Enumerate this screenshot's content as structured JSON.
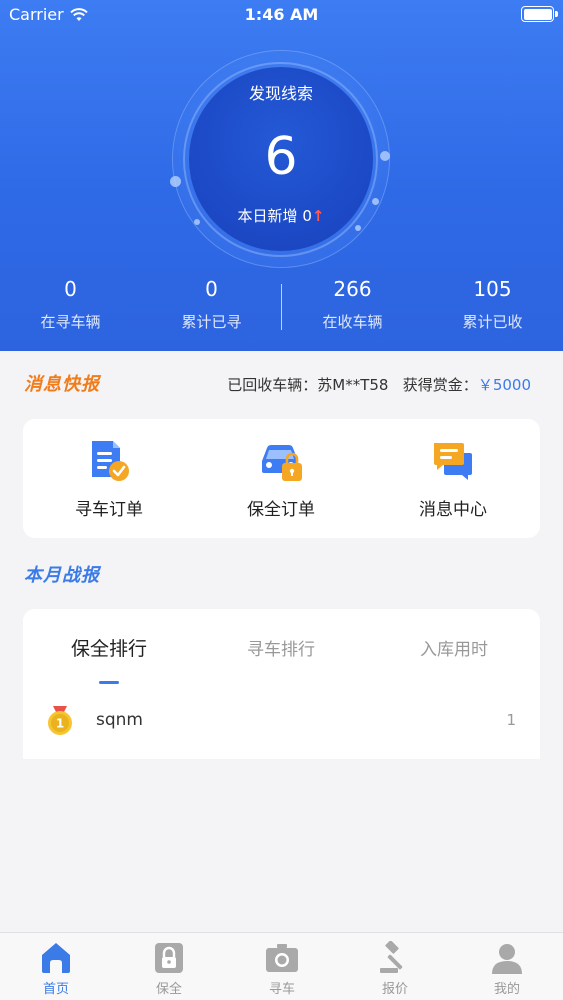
{
  "status_bar": {
    "carrier": "Carrier",
    "time": "1:46 AM"
  },
  "hero": {
    "circle_title": "发现线索",
    "circle_number": "6",
    "today_label": "本日新增",
    "today_value": "0",
    "stats": [
      {
        "value": "0",
        "label": "在寻车辆"
      },
      {
        "value": "0",
        "label": "累计已寻"
      },
      {
        "value": "266",
        "label": "在收车辆"
      },
      {
        "value": "105",
        "label": "累计已收"
      }
    ]
  },
  "news": {
    "logo": "消息快报",
    "recovered_label": "已回收车辆：",
    "recovered_plate": "苏M**T58",
    "reward_label": "获得赏金：",
    "reward_amount": "￥5000"
  },
  "shortcuts": [
    {
      "label": "寻车订单",
      "icon": "document-check-icon"
    },
    {
      "label": "保全订单",
      "icon": "car-lock-icon"
    },
    {
      "label": "消息中心",
      "icon": "chat-bubbles-icon"
    }
  ],
  "month_report": {
    "title": "本月战报",
    "tabs": [
      "保全排行",
      "寻车排行",
      "入库用时"
    ],
    "active_tab": 0,
    "rows": [
      {
        "medal": "gold-medal-icon",
        "rank": "1",
        "name": "sqnm",
        "value": "1"
      }
    ]
  },
  "tabbar": [
    {
      "label": "首页",
      "icon": "home-icon",
      "active": true
    },
    {
      "label": "保全",
      "icon": "lock-icon",
      "active": false
    },
    {
      "label": "寻车",
      "icon": "camera-icon",
      "active": false
    },
    {
      "label": "报价",
      "icon": "gavel-icon",
      "active": false
    },
    {
      "label": "我的",
      "icon": "user-icon",
      "active": false
    }
  ],
  "colors": {
    "hero_blue": "#3d7cf2",
    "circle_blue": "#1c48c4",
    "accent_blue": "#3a7be8",
    "news_orange": "#f07c1c",
    "up_arrow_red": "#ff5a4e"
  }
}
